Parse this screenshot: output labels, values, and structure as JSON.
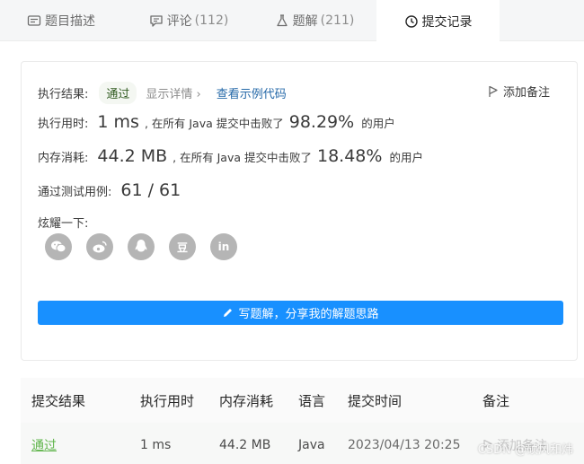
{
  "tabs": [
    {
      "label": "题目描述",
      "count": "",
      "icon": "description-icon"
    },
    {
      "label": "评论",
      "count": "(112)",
      "icon": "comment-icon"
    },
    {
      "label": "题解",
      "count": "(211)",
      "icon": "flask-icon"
    },
    {
      "label": "提交记录",
      "count": "",
      "icon": "clock-icon",
      "active": true
    }
  ],
  "result": {
    "status_label": "执行结果:",
    "status_value": "通过",
    "show_detail": "显示详情 ›",
    "view_example": "查看示例代码",
    "add_note": "添加备注",
    "runtime_label": "执行用时:",
    "runtime_value": "1 ms",
    "runtime_mid": ", 在所有 Java 提交中击败了",
    "runtime_pct": "98.29%",
    "runtime_tail": "的用户",
    "memory_label": "内存消耗:",
    "memory_value": "44.2 MB",
    "memory_mid": ", 在所有 Java 提交中击败了",
    "memory_pct": "18.48%",
    "memory_tail": "的用户",
    "tests_label": "通过测试用例:",
    "tests_value": "61 / 61",
    "share_label": "炫耀一下:",
    "write_button": "写题解，分享我的解题思路"
  },
  "share_icons": [
    "wechat-icon",
    "weibo-icon",
    "qq-icon",
    "douban-icon",
    "linkedin-icon"
  ],
  "share_glyphs": {
    "douban": "豆",
    "linkedin": "in"
  },
  "table": {
    "headers": [
      "提交结果",
      "执行用时",
      "内存消耗",
      "语言",
      "提交时间",
      "备注"
    ],
    "rows": [
      {
        "result": "通过",
        "runtime": "1 ms",
        "memory": "44.2 MB",
        "language": "Java",
        "time": "2023/04/13 20:25",
        "note": "添加备注"
      }
    ]
  },
  "watermark": "CSDN @硕风和炜",
  "colors": {
    "accent": "#1890ff",
    "pass": "#5fb54b",
    "link": "#2468a8"
  }
}
